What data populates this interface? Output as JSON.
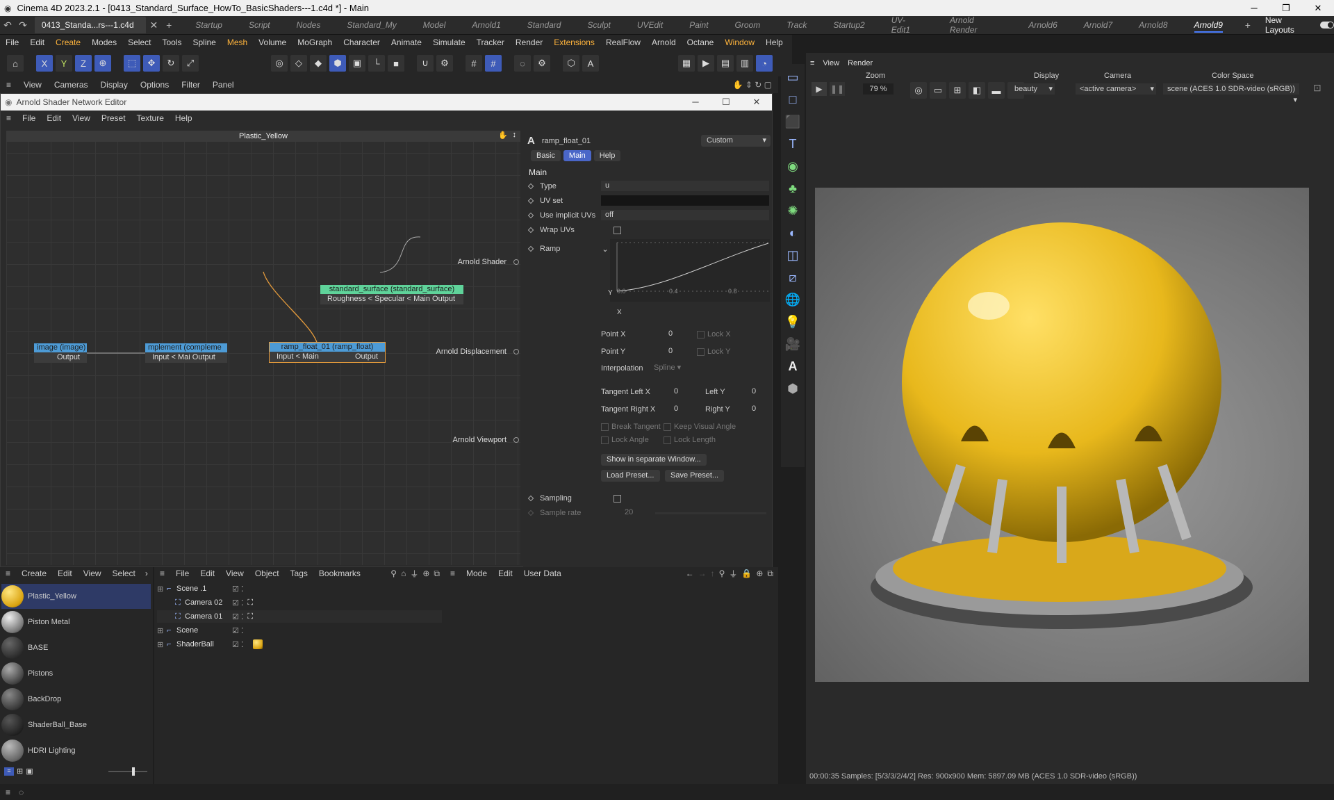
{
  "app": {
    "title": "Cinema 4D 2023.2.1 - [0413_Standard_Surface_HowTo_BasicShaders---1.c4d *] - Main"
  },
  "tabs": {
    "doc": "0413_Standa...rs---1.c4d *",
    "layouts": [
      "Startup",
      "Script",
      "Nodes",
      "Standard_My",
      "Model",
      "Arnold1",
      "Standard",
      "Sculpt",
      "UVEdit",
      "Paint",
      "Groom",
      "Track",
      "Startup2",
      "UV-Edit1",
      "Arnold Render",
      "Arnold6",
      "Arnold7",
      "Arnold8",
      "Arnold9"
    ],
    "active_layout": "Arnold9",
    "new_layouts": "New Layouts"
  },
  "menu": [
    "File",
    "Edit",
    "Create",
    "Modes",
    "Select",
    "Tools",
    "Spline",
    "Mesh",
    "Volume",
    "MoGraph",
    "Character",
    "Animate",
    "Simulate",
    "Tracker",
    "Render",
    "Extensions",
    "RealFlow",
    "Arnold",
    "Octane",
    "Window",
    "Help"
  ],
  "viewmenu": [
    "View",
    "Cameras",
    "Display",
    "Options",
    "Filter",
    "Panel"
  ],
  "editor": {
    "title": "Arnold Shader Network Editor",
    "menu": [
      "File",
      "Edit",
      "View",
      "Preset",
      "Texture",
      "Help"
    ],
    "material": "Plastic_Yellow",
    "nodes": {
      "image": {
        "title": "image (image)",
        "port": "Output"
      },
      "complement": {
        "title": "mplement (compleme",
        "port": "Input < Mai Output"
      },
      "ramp": {
        "title": "ramp_float_01 (ramp_float)",
        "in": "Input < Main",
        "out": "Output"
      },
      "standard": {
        "title": "standard_surface (standard_surface)",
        "port": "Roughness < Specular < Main Output"
      }
    },
    "outputs": [
      "Arnold Shader",
      "Arnold Displacement",
      "Arnold Viewport"
    ]
  },
  "attributes": {
    "node_name": "ramp_float_01",
    "preset": "Custom",
    "tabs": [
      "Basic",
      "Main",
      "Help"
    ],
    "active_tab": "Main",
    "section": "Main",
    "type_label": "Type",
    "type_value": "u",
    "uvset_label": "UV set",
    "uvset_value": "",
    "implicit_label": "Use implicit UVs",
    "implicit_value": "off",
    "wrap_label": "Wrap UVs",
    "ramp_label": "Ramp",
    "ramp_ticks": [
      "0.0",
      "0.4",
      "0.8"
    ],
    "ramp_axis_y": "Y",
    "ramp_axis_x": "X",
    "pointx_label": "Point X",
    "pointx_value": "0",
    "lockx": "Lock X",
    "pointy_label": "Point Y",
    "pointy_value": "0",
    "locky": "Lock Y",
    "interp_label": "Interpolation",
    "interp_value": "Spline",
    "tlx_label": "Tangent Left X",
    "tlx_value": "0",
    "ly_label": "Left Y",
    "ly_value": "0",
    "trx_label": "Tangent Right X",
    "trx_value": "0",
    "ry_label": "Right Y",
    "ry_value": "0",
    "break_tangent": "Break Tangent",
    "keep_visual": "Keep Visual Angle",
    "lock_angle": "Lock Angle",
    "lock_length": "Lock Length",
    "show_window": "Show in separate Window...",
    "load_preset": "Load Preset...",
    "save_preset": "Save Preset...",
    "sampling_label": "Sampling",
    "sample_rate_label": "Sample rate",
    "sample_rate_value": "20"
  },
  "viewport": {
    "menu": [
      "View",
      "Render"
    ],
    "zoom_label": "Zoom",
    "zoom_value": "79 %",
    "display_label": "Display",
    "display_value": "beauty",
    "camera_label": "Camera",
    "camera_value": "<active camera>",
    "colorspace_label": "Color Space",
    "colorspace_value": "scene (ACES 1.0 SDR-video (sRGB))",
    "status": "00:00:35  Samples: [5/3/3/2/4/2]  Res: 900x900  Mem: 5897.09 MB  (ACES 1.0 SDR-video (sRGB))"
  },
  "materials": {
    "menu": [
      "Create",
      "Edit",
      "View",
      "Select"
    ],
    "items": [
      "Plastic_Yellow",
      "Piston Metal",
      "BASE",
      "Pistons",
      "BackDrop",
      "ShaderBall_Base",
      "HDRI Lighting"
    ]
  },
  "objects": {
    "menu": [
      "File",
      "Edit",
      "View",
      "Object",
      "Tags",
      "Bookmarks"
    ],
    "items": [
      "Scene .1",
      "Camera 02",
      "Camera 01",
      "Scene",
      "ShaderBall"
    ]
  },
  "attrmgr": {
    "menu": [
      "Mode",
      "Edit",
      "User Data"
    ]
  },
  "colors": {
    "accent": "#4a66c8",
    "brand_menu": "#ffb43c",
    "node_green": "#5fd39a",
    "node_blue": "#4d9bd6",
    "yellow": "#e8b81c"
  }
}
